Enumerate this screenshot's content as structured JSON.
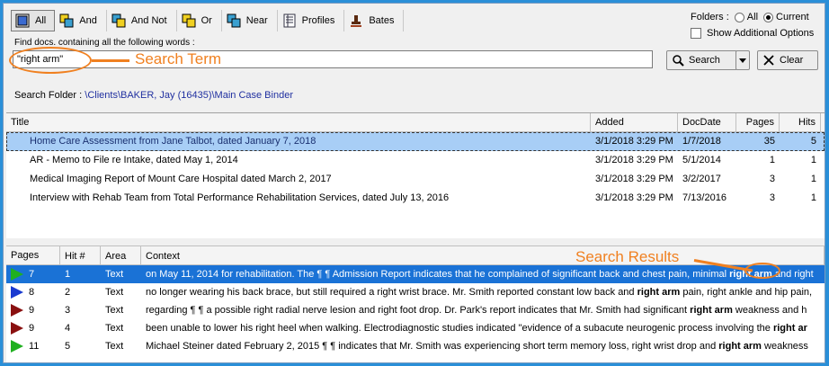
{
  "toolbar": {
    "buttons": [
      {
        "label": "All",
        "active": true
      },
      {
        "label": "And"
      },
      {
        "label": "And Not"
      },
      {
        "label": "Or"
      },
      {
        "label": "Near"
      },
      {
        "label": "Profiles"
      },
      {
        "label": "Bates"
      }
    ]
  },
  "folders": {
    "label": "Folders :",
    "opt_all": "All",
    "opt_current": "Current",
    "selected": "Current"
  },
  "additional_options": "Show Additional Options",
  "search": {
    "label": "Find docs. containing all the following words :",
    "value": "\"right arm\"",
    "search_btn": "Search",
    "clear_btn": "Clear"
  },
  "annotations": {
    "search_term": "Search Term",
    "search_results": "Search Results"
  },
  "folder_line": {
    "label": "Search Folder :",
    "path": "\\Clients\\BAKER, Jay (16435)\\Main Case Binder"
  },
  "docs": {
    "columns": [
      "Title",
      "Added",
      "DocDate",
      "Pages",
      "Hits"
    ],
    "rows": [
      {
        "title": "Home Care Assessment from Jane Talbot, dated January 7, 2018",
        "added": "3/1/2018 3:29 PM",
        "docdate": "1/7/2018",
        "pages": "35",
        "hits": "5"
      },
      {
        "title": "AR - Memo to File re Intake, dated May 1, 2014",
        "added": "3/1/2018 3:29 PM",
        "docdate": "5/1/2014",
        "pages": "1",
        "hits": "1"
      },
      {
        "title": "Medical Imaging Report of Mount Care Hospital dated March 2, 2017",
        "added": "3/1/2018 3:29 PM",
        "docdate": "3/2/2017",
        "pages": "3",
        "hits": "1"
      },
      {
        "title": "Interview with Rehab Team from Total Performance Rehabilitation Services, dated July 13, 2016",
        "added": "3/1/2018 3:29 PM",
        "docdate": "7/13/2016",
        "pages": "3",
        "hits": "1"
      }
    ]
  },
  "results": {
    "columns": [
      "Pages",
      "Hit #",
      "Area",
      "Context"
    ],
    "rows": [
      {
        "page": "7",
        "hit": "1",
        "area": "Text",
        "pre": "on May 11, 2014 for rehabilitation. The ¶  ¶ Admission Report indicates that he complained of significant back and chest pain, minimal ",
        "term": "right arm",
        "post": " and right",
        "color": "#20b020"
      },
      {
        "page": "8",
        "hit": "2",
        "area": "Text",
        "pre": "no longer wearing his back brace, but still required a right wrist brace. Mr. Smith reported constant low back and ",
        "term": "right arm",
        "post": " pain, right ankle and hip pain,",
        "color": "#1a3ad0"
      },
      {
        "page": "9",
        "hit": "3",
        "area": "Text",
        "pre": "regarding ¶  ¶ a possible right radial nerve lesion and right foot drop. Dr. Park's report indicates that Mr. Smith had significant ",
        "term": "right arm",
        "post": " weakness and h",
        "color": "#8a1010"
      },
      {
        "page": "9",
        "hit": "4",
        "area": "Text",
        "pre": "been unable to lower his right heel when walking. Electrodiagnostic studies indicated \"evidence of a subacute neurogenic process involving the ",
        "term": "right ar",
        "post": "",
        "color": "#8a1010"
      },
      {
        "page": "11",
        "hit": "5",
        "area": "Text",
        "pre": "Michael Steiner dated February 2, 2015 ¶  ¶ indicates that Mr. Smith was experiencing short term memory loss, right wrist drop and ",
        "term": "right arm",
        "post": " weakness",
        "color": "#20b020"
      }
    ]
  },
  "colors": {
    "accent": "#f08020",
    "selected_row": "#1a72d6",
    "frame": "#2a8fd8"
  }
}
